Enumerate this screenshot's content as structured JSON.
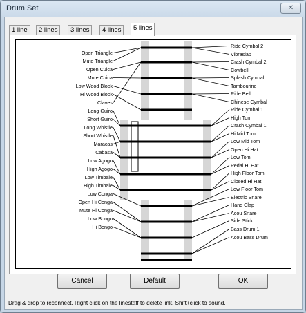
{
  "window": {
    "title": "Drum Set",
    "close_glyph": "✕",
    "close_icon": "close-icon"
  },
  "tabs": [
    {
      "label": "1 line"
    },
    {
      "label": "2 lines"
    },
    {
      "label": "3 lines"
    },
    {
      "label": "4 lines"
    },
    {
      "label": "5 lines",
      "active": true
    }
  ],
  "left_instruments": [
    "Open Triangle",
    "Mute Triangle",
    "Open Cuica",
    "Mute Cuica",
    "Low Wood Block",
    "Hi Wood Block",
    "Claves",
    "Long Guiro",
    "Short Guiro",
    "Long Whistle",
    "Short Whistle",
    "Maracas",
    "Cabasa",
    "Low Agogo",
    "High Agogo",
    "Low Timbale",
    "High Timbale",
    "Low Conga",
    "Open Hi Conga",
    "Mute Hi Conga",
    "Low Bongo",
    "Hi Bongo"
  ],
  "right_instruments": [
    "Ride Cymbal 2",
    "Vibraslap",
    "Crash Cymbal 2",
    "Cowbell",
    "Splash Cymbal",
    "Tambourine",
    "Ride Bell",
    "Chinese Cymbal",
    "Ride Cymbal 1",
    "High Tom",
    "Crash Cymbal 1",
    "Hi Mid Tom",
    "Low Mid Tom",
    "Open Hi Hat",
    "Low Tom",
    "Pedal Hi Hat",
    "High Floor Tom",
    "Closed Hi Hat",
    "Low Floor Tom",
    "Electric Snare",
    "Hand Clap",
    "Acou Snare",
    "Side Stick",
    "Bass Drum 1",
    "Acou Bass Drum"
  ],
  "buttons": {
    "cancel": "Cancel",
    "default": "Default",
    "ok": "OK"
  },
  "status": "Drag & drop to reconnect. Right click on the linestaff to delete link. Shift+click to sound."
}
